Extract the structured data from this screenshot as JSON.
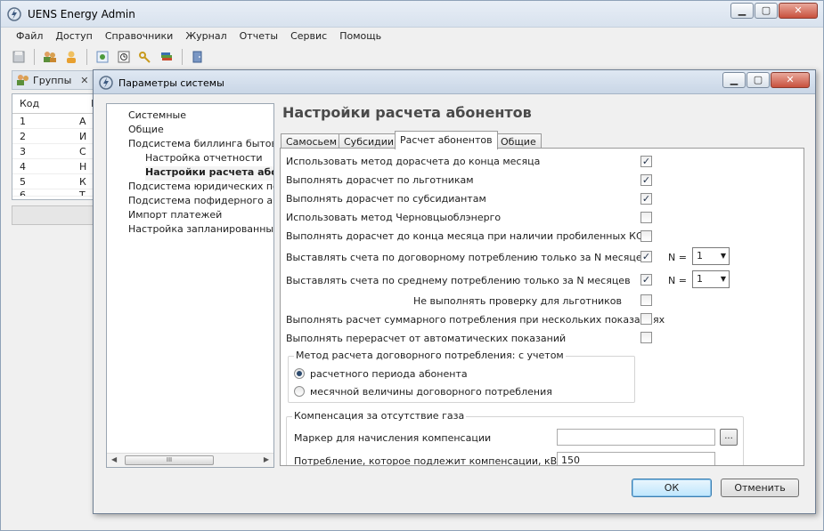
{
  "main": {
    "title": "UENS Energy Admin",
    "menu": [
      "Файл",
      "Доступ",
      "Справочники",
      "Журнал",
      "Отчеты",
      "Сервис",
      "Помощь"
    ],
    "groups_panel": {
      "title": "Группы",
      "column_code": "Код",
      "column_name": "И",
      "rows": [
        {
          "code": "1",
          "name": "А"
        },
        {
          "code": "2",
          "name": "И"
        },
        {
          "code": "3",
          "name": "С"
        },
        {
          "code": "4",
          "name": "Н"
        },
        {
          "code": "5",
          "name": "К"
        },
        {
          "code": "6",
          "name": "Т"
        }
      ]
    }
  },
  "dialog": {
    "title": "Параметры системы",
    "heading": "Настройки расчета абонентов",
    "tree": {
      "items": [
        {
          "label": "Системные",
          "level": 0
        },
        {
          "label": "Общие",
          "level": 0
        },
        {
          "label": "Подсистема биллинга бытовых",
          "level": 0
        },
        {
          "label": "Настройка отчетности",
          "level": 1
        },
        {
          "label": "Настройки расчета абонен",
          "level": 1,
          "selected": true
        },
        {
          "label": "Подсистема юридических потр",
          "level": 0
        },
        {
          "label": "Подсистема пофидерного ана",
          "level": 0
        },
        {
          "label": "Импорт платежей",
          "level": 0
        },
        {
          "label": "Настройка запланированных з",
          "level": 0
        }
      ],
      "scroll_thumb_label": "III"
    },
    "tabs": [
      {
        "label": "Самосьем",
        "active": false
      },
      {
        "label": "Субсидии",
        "active": false
      },
      {
        "label": "Расчет абонентов",
        "active": true
      },
      {
        "label": "Общие",
        "active": false
      }
    ],
    "options": [
      {
        "label": "Использовать метод дорасчета до конца месяца",
        "checked": true
      },
      {
        "label": "Выполнять дорасчет по льготникам",
        "checked": true
      },
      {
        "label": "Выполнять дорасчет по субсидиантам",
        "checked": true
      },
      {
        "label": "Использовать метод Черновцыоблэнерго",
        "checked": false
      },
      {
        "label": "Выполнять дорасчет до конца месяца при наличии пробиленных КС",
        "checked": false
      },
      {
        "label": "Выставлять счета по договорному потреблению только за N месяцев",
        "checked": true,
        "n_label": "N =",
        "n_value": "1"
      },
      {
        "label": "Выставлять счета по среднему потреблению только за N месяцев",
        "checked": true,
        "n_label": "N =",
        "n_value": "1"
      },
      {
        "label": "Не выполнять проверку для льготников",
        "checked": false
      },
      {
        "label": "Выполнять расчет суммарного потребления при нескольких показаниях",
        "checked": false
      },
      {
        "label": "Выполнять перерасчет от автоматических показаний",
        "checked": false
      }
    ],
    "contract_method": {
      "title": "Метод расчета договорного потребления: с учетом",
      "options": [
        {
          "label": "расчетного периода абонента",
          "selected": true
        },
        {
          "label": "месячной величины договорного потребления",
          "selected": false
        }
      ]
    },
    "compensation": {
      "title": "Компенсация за отсутствие газа",
      "marker_label": "Маркер для начисления компенсации",
      "marker_value": "",
      "browse_label": "...",
      "consumption_label": "Потребление, которое подлежит компенсации, кВт*ч",
      "consumption_value": "150"
    },
    "ok_label": "ОК",
    "cancel_label": "Отменить"
  }
}
